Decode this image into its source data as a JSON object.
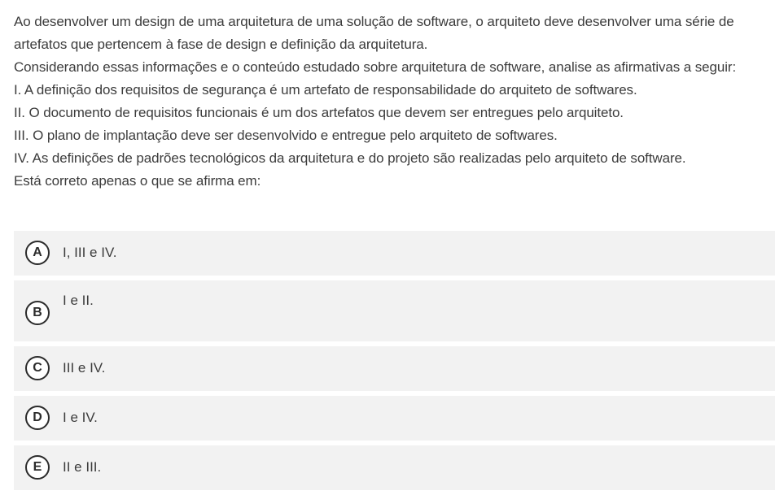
{
  "question": {
    "lines": [
      "Ao desenvolver um design de uma arquitetura de uma solução de software, o arquiteto deve desenvolver uma série de artefatos que pertencem à fase de design e definição da arquitetura.",
      "Considerando essas informações e o conteúdo estudado sobre arquitetura de software, analise as afirmativas a seguir:",
      "I. A definição dos requisitos de segurança é um artefato de responsabilidade do arquiteto de softwares.",
      "II. O documento de requisitos funcionais é um dos artefatos que devem ser entregues pelo arquiteto.",
      "III. O plano de implantação deve ser desenvolvido e entregue pelo arquiteto de softwares.",
      "IV. As definições de padrões tecnológicos da arquitetura e do projeto são realizadas pelo arquiteto de software.",
      "Está correto apenas o que se afirma em:"
    ]
  },
  "options": [
    {
      "letter": "A",
      "label": "I, III e IV."
    },
    {
      "letter": "B",
      "label": "I e II."
    },
    {
      "letter": "C",
      "label": "III e IV."
    },
    {
      "letter": "D",
      "label": "I e IV."
    },
    {
      "letter": "E",
      "label": "II e III."
    }
  ]
}
